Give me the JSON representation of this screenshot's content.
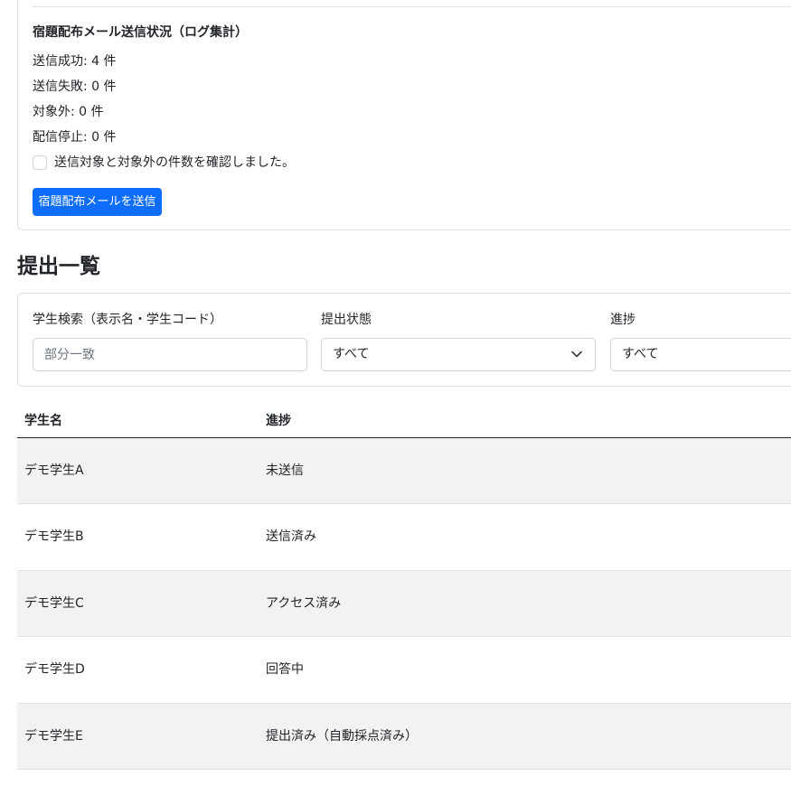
{
  "mail_status": {
    "title": "宿題配布メール送信状況（ログ集計）",
    "success": "送信成功: 4 件",
    "failed": "送信失敗: 0 件",
    "excluded": "対象外: 0 件",
    "stopped": "配信停止: 0 件",
    "confirm_label": "送信対象と対象外の件数を確認しました。",
    "confirm_checked": false,
    "send_button_label": "宿題配布メールを送信",
    "send_button_color": "#0d6efd"
  },
  "submissions": {
    "title": "提出一覧",
    "filters": {
      "search_label": "学生検索（表示名・学生コード）",
      "search_placeholder": "部分一致",
      "search_value": "",
      "status_label": "提出状態",
      "status_value": "すべて",
      "progress_label": "進捗",
      "progress_value": "すべて"
    },
    "table": {
      "headers": {
        "name": "学生名",
        "progress": "進捗"
      },
      "rows": [
        {
          "name": "デモ学生A",
          "progress": "未送信"
        },
        {
          "name": "デモ学生B",
          "progress": "送信済み"
        },
        {
          "name": "デモ学生C",
          "progress": "アクセス済み"
        },
        {
          "name": "デモ学生D",
          "progress": "回答中"
        },
        {
          "name": "デモ学生E",
          "progress": "提出済み（自動採点済み）"
        }
      ]
    }
  }
}
